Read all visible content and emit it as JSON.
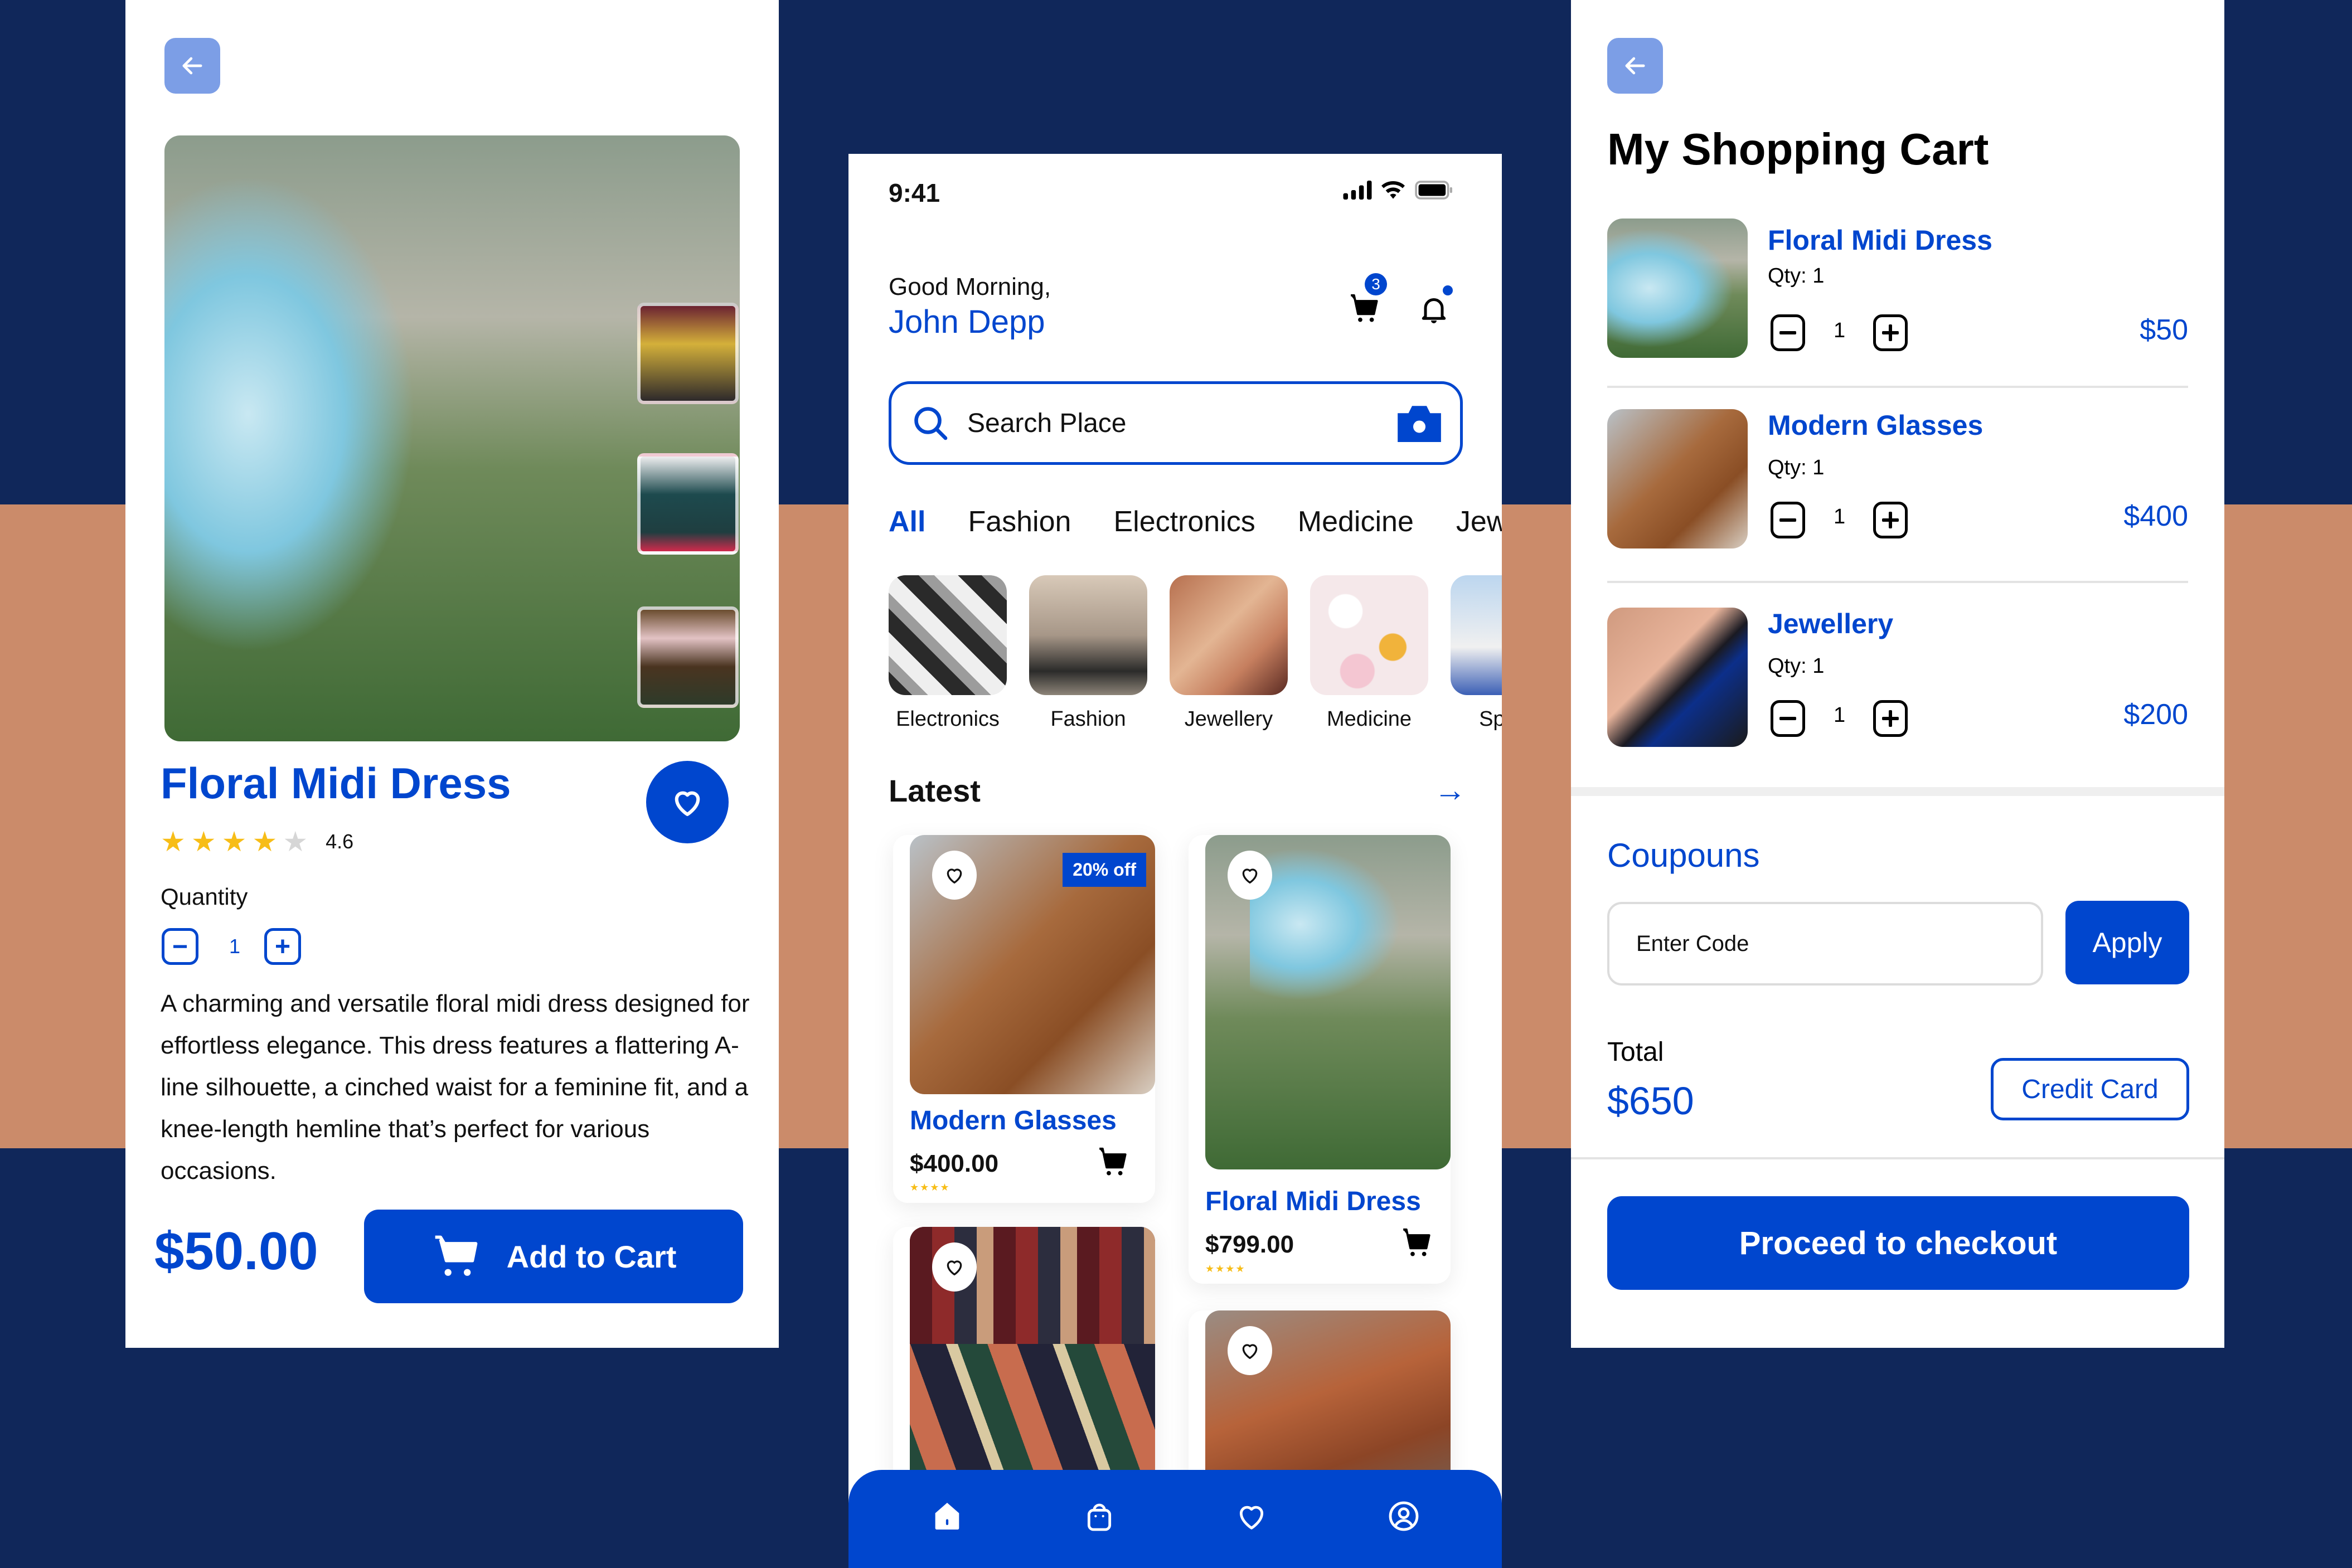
{
  "colors": {
    "background_navy": "#10275a",
    "band_tan": "#cb8b6a",
    "primary_blue": "#0046ce",
    "back_button": "#7c9ee6",
    "star_yellow": "#f7bd17",
    "star_empty": "#d6d6d6"
  },
  "detail": {
    "back_icon": "arrow-left-icon",
    "gallery_thumbnails": [
      "thumb-1",
      "thumb-2",
      "thumb-3"
    ],
    "title": "Floral Midi Dress",
    "favorite_icon": "heart-icon",
    "rating": {
      "value": "4.6",
      "stars_filled": 4,
      "stars_total": 5
    },
    "quantity_label": "Quantity",
    "quantity_value": "1",
    "minus": "−",
    "plus": "+",
    "description": "A charming and versatile floral midi dress designed for effortless elegance. This dress features a flattering A-line silhouette, a cinched waist for a feminine fit, and a knee-length hemline that’s perfect for various occasions.",
    "price": "$50.00",
    "add_to_cart_label": "Add to Cart"
  },
  "home": {
    "status_time": "9:41",
    "greeting": "Good Morning,",
    "user_name": "John Depp",
    "cart_badge": "3",
    "search_placeholder": "Search Place",
    "tabs": [
      {
        "label": "All",
        "active": true
      },
      {
        "label": "Fashion",
        "active": false
      },
      {
        "label": "Electronics",
        "active": false
      },
      {
        "label": "Medicine",
        "active": false
      },
      {
        "label": "Jewellery",
        "active": false
      }
    ],
    "categories": [
      {
        "label": "Electronics"
      },
      {
        "label": "Fashion"
      },
      {
        "label": "Jewellery"
      },
      {
        "label": "Medicine"
      },
      {
        "label": "Sports"
      }
    ],
    "latest_title": "Latest",
    "latest_arrow": "→",
    "products": [
      {
        "name": "Modern Glasses",
        "price": "$400.00",
        "badge": "20% off",
        "stars": "★★★★"
      },
      {
        "name": "Floral Midi Dress",
        "price": "$799.00",
        "badge": "",
        "stars": "★★★★"
      },
      {
        "name": "",
        "price": "",
        "badge": "",
        "stars": ""
      },
      {
        "name": "",
        "price": "",
        "badge": "",
        "stars": ""
      }
    ],
    "nav": [
      "home-icon",
      "bag-icon",
      "heart-icon",
      "profile-icon"
    ]
  },
  "cart": {
    "title": "My Shopping Cart",
    "items": [
      {
        "name": "Floral Midi Dress",
        "qty_label": "Qty: 1",
        "qty": "1",
        "price": "$50"
      },
      {
        "name": "Modern Glasses",
        "qty_label": "Qty: 1",
        "qty": "1",
        "price": "$400"
      },
      {
        "name": "Jewellery",
        "qty_label": "Qty: 1",
        "qty": "1",
        "price": "$200"
      }
    ],
    "coupons_label": "Coupouns",
    "coupon_placeholder": "Enter Code",
    "apply_label": "Apply",
    "total_label": "Total",
    "total_value": "$650",
    "payment_method": "Credit Card",
    "checkout_label": "Proceed to checkout"
  }
}
